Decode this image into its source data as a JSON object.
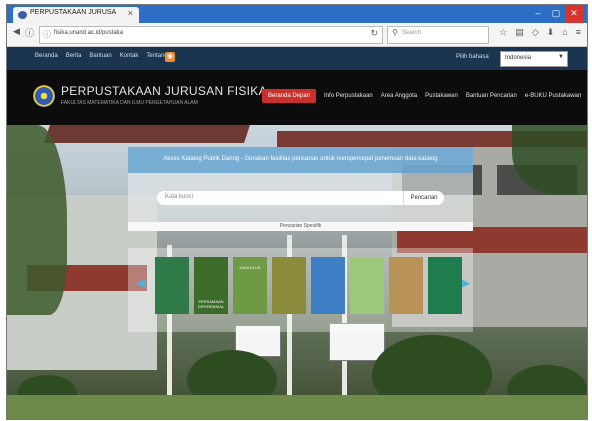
{
  "browser": {
    "tab_title": "PERPUSTAKAAN JURUSA",
    "address": "fisika.unand.ac.id/pustaka",
    "search_placeholder": "Search"
  },
  "topbar": {
    "links": [
      "Beranda",
      "Berita",
      "Bantuan",
      "Kontak",
      "Tentang"
    ],
    "lang_label": "Pilih bahasa",
    "lang_value": "Indonesia"
  },
  "site": {
    "title": "PERPUSTAKAAN JURUSAN FISIKA",
    "subtitle": "FAKULTAS MATEMATIKA DAN ILMU PENGETAHUAN ALAM"
  },
  "menu": [
    "Beranda Depan",
    "Info Perpustakaan",
    "Area Anggota",
    "Pustakawan",
    "Bantuan Pencarian",
    "e-BUKU Pustakawan"
  ],
  "opac": {
    "heading": "Akses Katalog Publik Daring - Gunakan fasilitas pencarian untuk mempercepat penemuan data katalog",
    "search_placeholder": "Kata kunci",
    "search_button": "Pencarian",
    "advanced": "Pencarian Spesifik"
  },
  "books": [
    {
      "title": "",
      "color": "#2f7a47"
    },
    {
      "title": "PERSAMAAN DIFERENSIAL",
      "color": "#3c6b2a"
    },
    {
      "title": "KALKULUS",
      "color": "#6f9a45"
    },
    {
      "title": "",
      "color": "#8a8c3c"
    },
    {
      "title": "",
      "color": "#3f7fc6"
    },
    {
      "title": "",
      "color": "#9bc979"
    },
    {
      "title": "",
      "color": "#b89256"
    },
    {
      "title": "",
      "color": "#1f7c4f"
    }
  ],
  "colors": {
    "titlebar": "#2b6ec4",
    "topbar": "#1b3550",
    "header": "#0c0c0c",
    "menu_active": "#c9302c",
    "opac_header": "#72aad4",
    "carousel_arrow": "#4fb3d9"
  }
}
